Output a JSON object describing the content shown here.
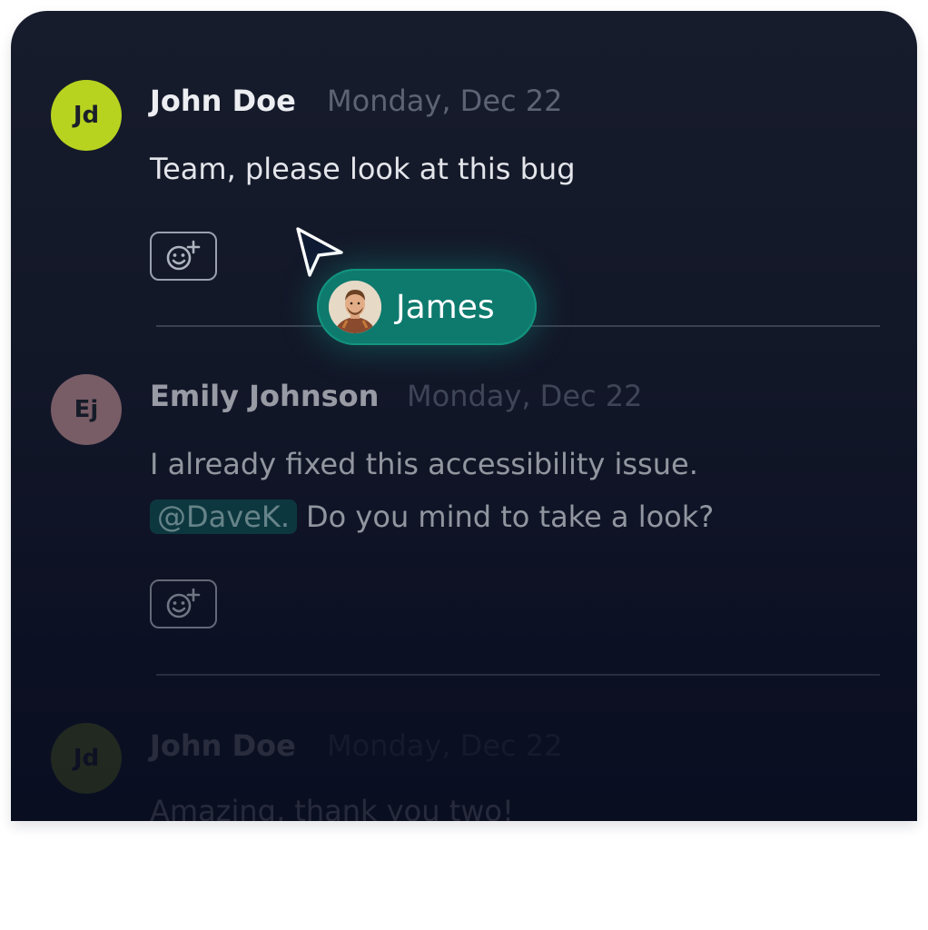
{
  "messages": [
    {
      "initials": "Jd",
      "author": "John Doe",
      "date": "Monday, Dec 22",
      "text": "Team, please look at this bug",
      "avatar_color": "#b7d320"
    },
    {
      "initials": "Ej",
      "author": "Emily Johnson",
      "date": "Monday, Dec 22",
      "text_line1": "I already fixed this accessibility issue.",
      "mention": "@DaveK.",
      "text_line2": "Do you mind to take a look?",
      "avatar_color": "#b98a8f"
    },
    {
      "initials": "Jd",
      "author": "John Doe",
      "date": "Monday, Dec 22",
      "text": "Amazing, thank you two!",
      "avatar_color": "#b7d320"
    }
  ],
  "collaborator": {
    "name": "James",
    "color": "#0e7a6e"
  },
  "icons": {
    "reaction": "add-reaction-icon",
    "cursor": "pointer-cursor-icon"
  }
}
